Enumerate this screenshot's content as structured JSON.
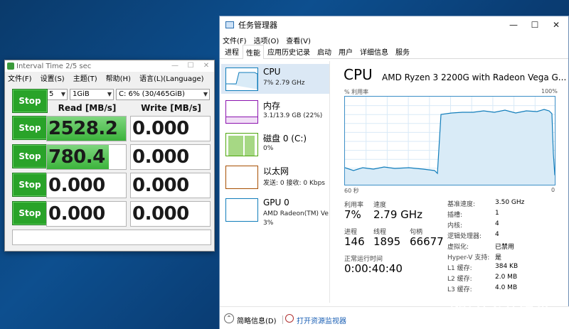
{
  "cdm": {
    "title": "Interval Time 2/5 sec",
    "menu": [
      "文件(F)",
      "设置(S)",
      "主题(T)",
      "帮助(H)",
      "语言(L)(Language)"
    ],
    "count": "5",
    "size": "1GiB",
    "drive": "C: 6% (30/465GiB)",
    "read_header": "Read [MB/s]",
    "write_header": "Write [MB/s]",
    "stop_label": "Stop",
    "rows": [
      {
        "read": "2528.2",
        "write": "0.000",
        "read_fill": 1.0
      },
      {
        "read": "780.4",
        "write": "0.000",
        "read_fill": 0.78
      },
      {
        "read": "0.000",
        "write": "0.000",
        "read_fill": 0
      },
      {
        "read": "0.000",
        "write": "0.000",
        "read_fill": 0
      }
    ]
  },
  "tm": {
    "title": "任务管理器",
    "menu": [
      "文件(F)",
      "选项(O)",
      "查看(V)"
    ],
    "tabs": [
      "进程",
      "性能",
      "应用历史记录",
      "启动",
      "用户",
      "详细信息",
      "服务"
    ],
    "active_tab": "性能",
    "sidebar": [
      {
        "title": "CPU",
        "sub": "7% 2.79 GHz",
        "sub2": ""
      },
      {
        "title": "内存",
        "sub": "3.1/13.9 GB (22%)",
        "sub2": ""
      },
      {
        "title": "磁盘 0 (C:)",
        "sub": "0%",
        "sub2": ""
      },
      {
        "title": "以太网",
        "sub": "发送: 0 接收: 0 Kbps",
        "sub2": ""
      },
      {
        "title": "GPU 0",
        "sub": "AMD Radeon(TM) Veg",
        "sub2": "3%"
      }
    ],
    "main": {
      "title": "CPU",
      "processor": "AMD Ryzen 3 2200G with Radeon Vega G...",
      "util_label": "% 利用率",
      "util_max": "100%",
      "time_left": "60 秒",
      "time_right": "0",
      "stats": {
        "util_label": "利用率",
        "util": "7%",
        "speed_label": "速度",
        "speed": "2.79 GHz",
        "proc_label": "进程",
        "proc": "146",
        "threads_label": "线程",
        "threads": "1895",
        "handles_label": "句柄",
        "handles": "66677",
        "uptime_label": "正常运行时间",
        "uptime": "0:00:40:40"
      },
      "details": [
        {
          "k": "基准速度:",
          "v": "3.50 GHz"
        },
        {
          "k": "插槽:",
          "v": "1"
        },
        {
          "k": "内核:",
          "v": "4"
        },
        {
          "k": "逻辑处理器:",
          "v": "4"
        },
        {
          "k": "虚拟化:",
          "v": "已禁用"
        },
        {
          "k": "Hyper-V 支持:",
          "v": "是"
        },
        {
          "k": "L1 缓存:",
          "v": "384 KB"
        },
        {
          "k": "L2 缓存:",
          "v": "2.0 MB"
        },
        {
          "k": "L3 缓存:",
          "v": "4.0 MB"
        }
      ]
    },
    "footer": {
      "less": "简略信息(D)",
      "monitor": "打开资源监视器"
    }
  },
  "watermark": "什么值得买",
  "watermark_logo": "值",
  "colors": {
    "cpu_blue": "#117dbb",
    "mem_purple": "#8b12ae",
    "disk_green": "#4da60c",
    "net_brown": "#a74f01",
    "stop_green": "#29a329"
  }
}
